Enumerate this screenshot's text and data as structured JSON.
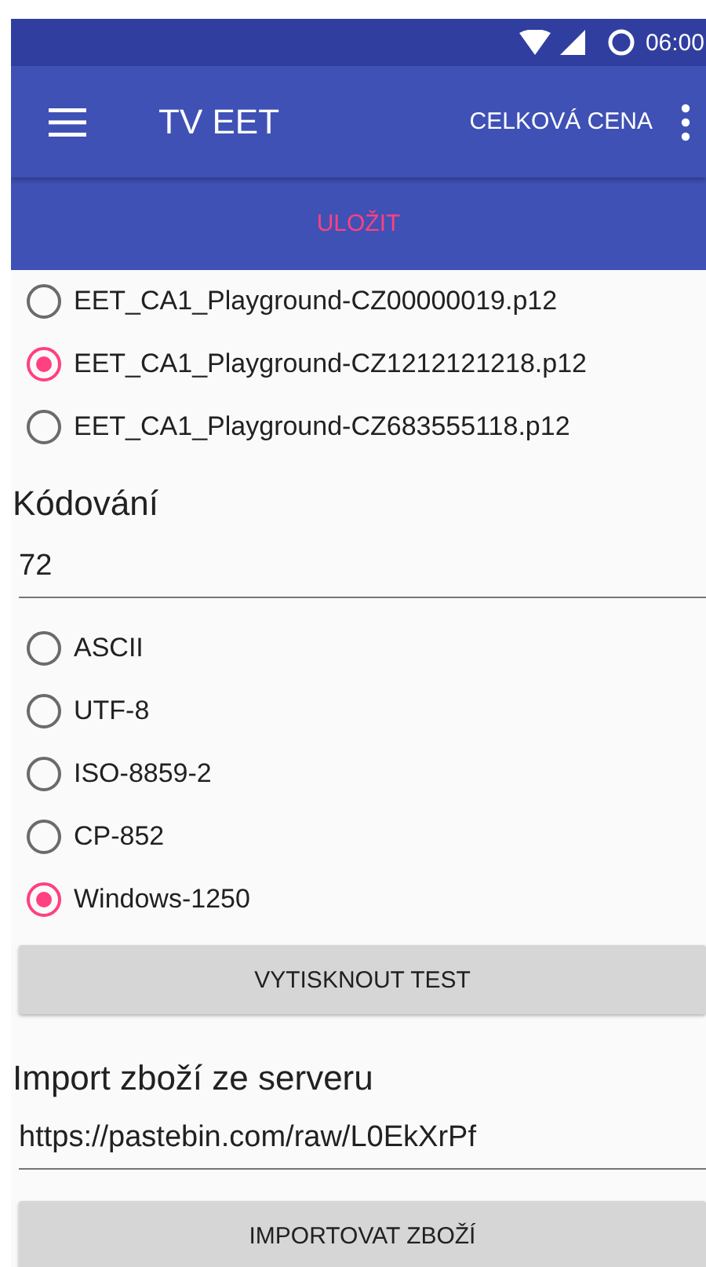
{
  "status_bar": {
    "time": "06:00"
  },
  "toolbar": {
    "title": "TV EET",
    "action": "CELKOVÁ CENA"
  },
  "save_button": {
    "label": "ULOŽIT"
  },
  "certificates": [
    {
      "label": "EET_CA1_Playground-CZ00000019.p12",
      "selected": false
    },
    {
      "label": "EET_CA1_Playground-CZ1212121218.p12",
      "selected": true
    },
    {
      "label": "EET_CA1_Playground-CZ683555118.p12",
      "selected": false
    }
  ],
  "encoding": {
    "heading": "Kódování",
    "value": "72",
    "options": [
      {
        "label": "ASCII",
        "selected": false
      },
      {
        "label": "UTF-8",
        "selected": false
      },
      {
        "label": "ISO-8859-2",
        "selected": false
      },
      {
        "label": "CP-852",
        "selected": false
      },
      {
        "label": "Windows-1250",
        "selected": true
      }
    ]
  },
  "print_test_button": {
    "label": "VYTISKNOUT TEST"
  },
  "import": {
    "heading": "Import zboží ze serveru",
    "url": "https://pastebin.com/raw/L0EkXrPf",
    "button": "IMPORTOVAT ZBOŽÍ"
  }
}
